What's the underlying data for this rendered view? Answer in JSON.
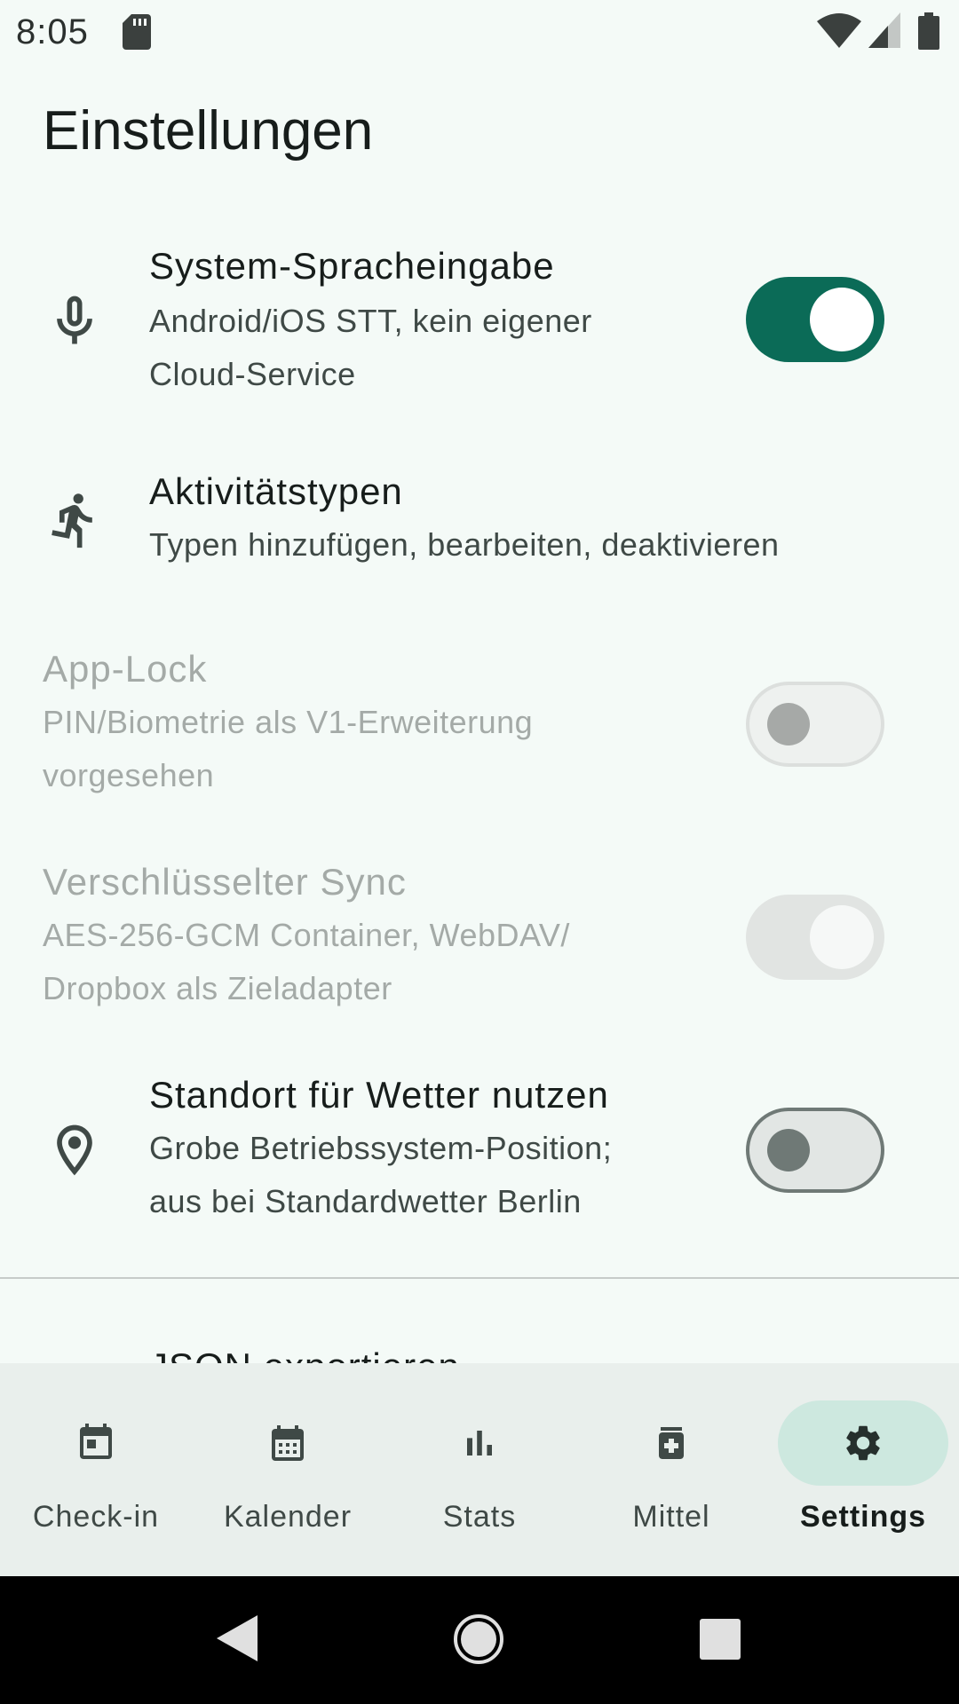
{
  "status_bar": {
    "time": "8:05",
    "icons": [
      "sd-card-icon",
      "wifi-icon",
      "cell-signal-icon",
      "battery-icon"
    ]
  },
  "page": {
    "title": "Einstellungen"
  },
  "settings": [
    {
      "id": "voice",
      "icon": "microphone-icon",
      "title": "System-Spracheingabe",
      "subtitle_lines": [
        "Android/iOS STT, kein eigener",
        "Cloud-Service"
      ],
      "switch": {
        "on": true,
        "enabled": true
      }
    },
    {
      "id": "activities",
      "icon": "running-person-icon",
      "title": "Aktivitätstypen",
      "subtitle_lines": [
        "Typen hinzufügen, bearbeiten, deaktivieren"
      ]
    },
    {
      "id": "applock",
      "title": "App-Lock",
      "subtitle_lines": [
        "PIN/Biometrie als V1-Erweiterung",
        "vorgesehen"
      ],
      "switch": {
        "on": false,
        "enabled": false
      }
    },
    {
      "id": "sync",
      "title": "Verschlüsselter Sync",
      "subtitle_lines": [
        "AES-256-GCM Container, WebDAV/",
        "Dropbox als Zieladapter"
      ],
      "switch": {
        "on": true,
        "enabled": false
      }
    },
    {
      "id": "location",
      "icon": "location-pin-icon",
      "title": "Standort für Wetter nutzen",
      "subtitle_lines": [
        "Grobe Betriebssystem-Position;",
        "aus bei Standardwetter Berlin"
      ],
      "switch": {
        "on": false,
        "enabled": true
      }
    }
  ],
  "partial_item": {
    "title": "JSON exportieren"
  },
  "bottom_nav": {
    "items": [
      {
        "label": "Check-in",
        "icon": "calendar-today-icon",
        "active": false
      },
      {
        "label": "Kalender",
        "icon": "calendar-month-icon",
        "active": false
      },
      {
        "label": "Stats",
        "icon": "bar-chart-icon",
        "active": false
      },
      {
        "label": "Mittel",
        "icon": "medication-icon",
        "active": false
      },
      {
        "label": "Settings",
        "icon": "gear-icon",
        "active": true
      }
    ],
    "colors": {
      "active_indicator": "#cde8df",
      "background": "#e9efec"
    }
  },
  "colors": {
    "accent": "#0b6b57",
    "background": "#f4faf7"
  },
  "system_nav": {
    "icons": [
      "back-icon",
      "home-icon",
      "recents-icon"
    ]
  }
}
